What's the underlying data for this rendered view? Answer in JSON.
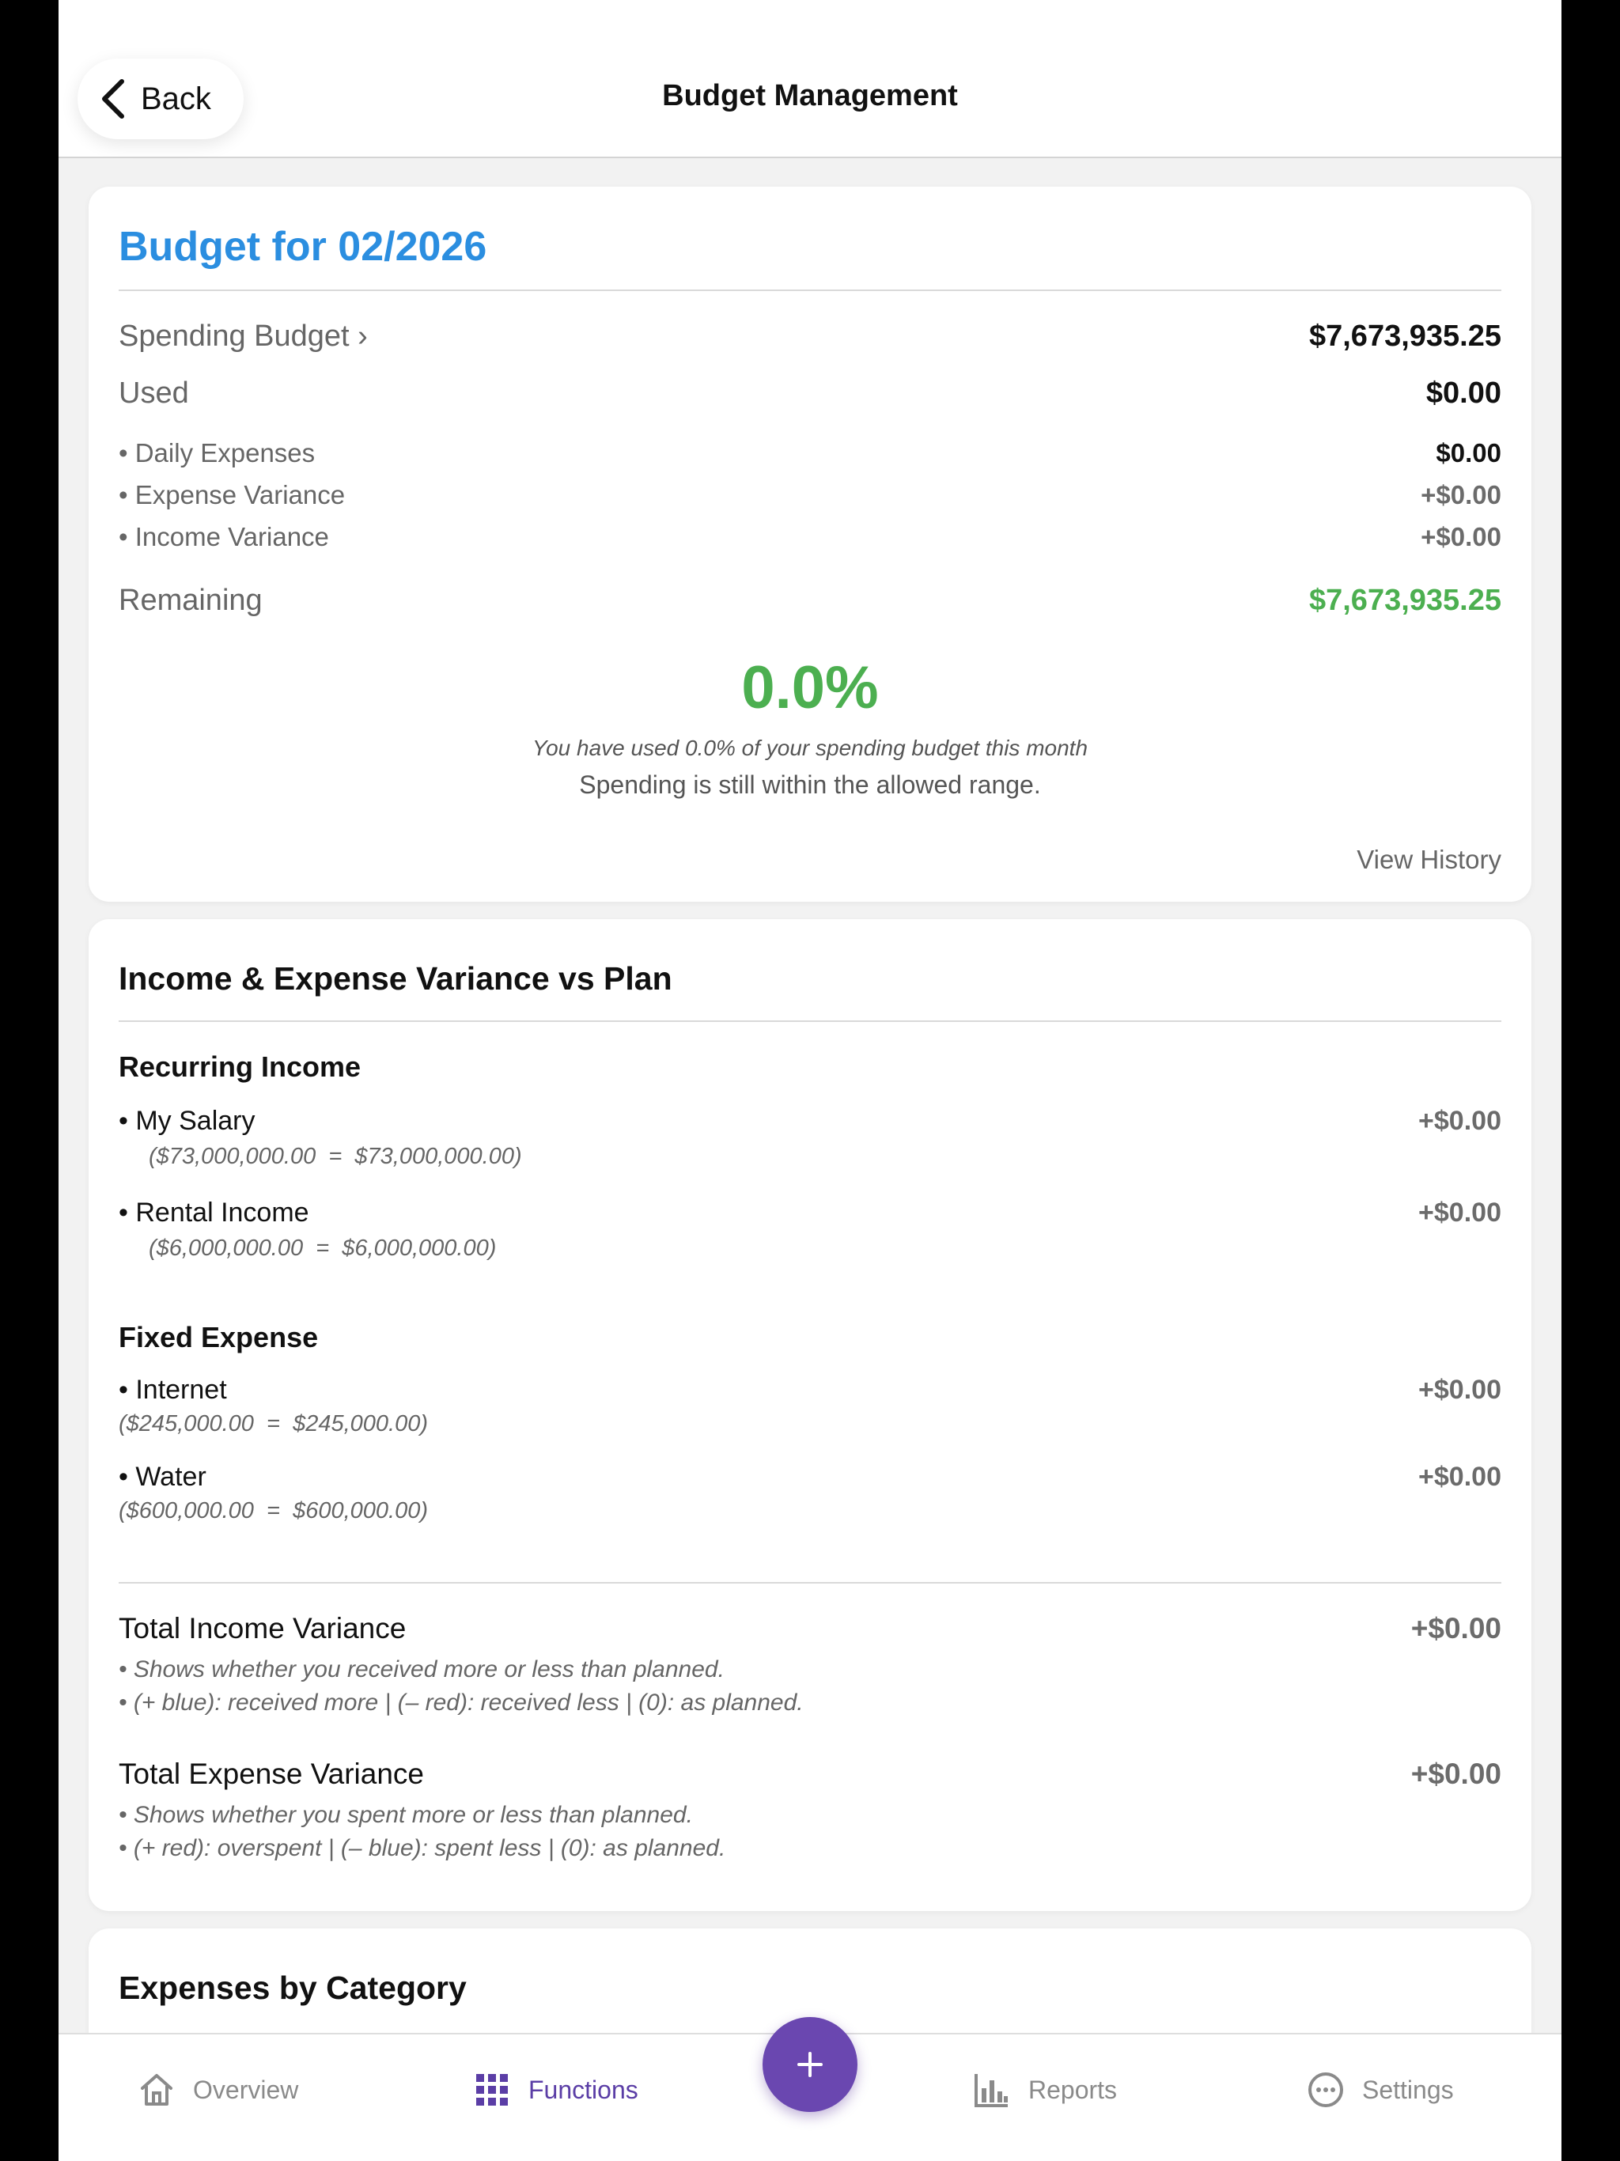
{
  "header": {
    "back_label": "Back",
    "title": "Budget Management"
  },
  "budget": {
    "title": "Budget for 02/2026",
    "spending_budget_label": "Spending Budget ›",
    "spending_budget_value": "$7,673,935.25",
    "used_label": "Used",
    "used_value": "$0.00",
    "breakdown": [
      {
        "label": "• Daily Expenses",
        "value": "$0.00"
      },
      {
        "label": "• Expense Variance",
        "value": "+$0.00"
      },
      {
        "label": "• Income Variance",
        "value": "+$0.00"
      }
    ],
    "remaining_label": "Remaining",
    "remaining_value": "$7,673,935.25",
    "percent": "0.0%",
    "percent_caption": "You have used 0.0% of your spending budget this month",
    "status_text": "Spending is still within the allowed range.",
    "view_history": "View History"
  },
  "variance": {
    "title": "Income & Expense Variance vs Plan",
    "recurring_income": {
      "title": "Recurring Income",
      "items": [
        {
          "name": "• My Salary",
          "value": "+$0.00",
          "formula": "($73,000,000.00  =  $73,000,000.00)"
        },
        {
          "name": "• Rental Income",
          "value": "+$0.00",
          "formula": "($6,000,000.00  =  $6,000,000.00)"
        }
      ]
    },
    "fixed_expense": {
      "title": "Fixed Expense",
      "items": [
        {
          "name": "• Internet",
          "value": "+$0.00",
          "formula": "($245,000.00  =  $245,000.00)"
        },
        {
          "name": "• Water",
          "value": "+$0.00",
          "formula": "($600,000.00  =  $600,000.00)"
        }
      ]
    },
    "total_income": {
      "label": "Total Income Variance",
      "value": "+$0.00",
      "note1": "• Shows whether you received more or less than planned.",
      "note2": "• (+ blue): received more | (– red): received less | (0): as planned."
    },
    "total_expense": {
      "label": "Total Expense Variance",
      "value": "+$0.00",
      "note1": "• Shows whether you spent more or less than planned.",
      "note2": "• (+ red): overspent | (– blue): spent less | (0): as planned."
    }
  },
  "expenses_by_category": {
    "title": "Expenses by Category"
  },
  "tabbar": {
    "overview": "Overview",
    "functions": "Functions",
    "reports": "Reports",
    "settings": "Settings",
    "active": "functions"
  },
  "colors": {
    "accent_blue": "#2b8ee0",
    "positive_green": "#4caf50",
    "brand_purple": "#6a47b0"
  },
  "icons": [
    "chevron-left-icon",
    "home-icon",
    "grid-icon",
    "plus-icon",
    "bar-chart-icon",
    "more-circle-icon"
  ]
}
